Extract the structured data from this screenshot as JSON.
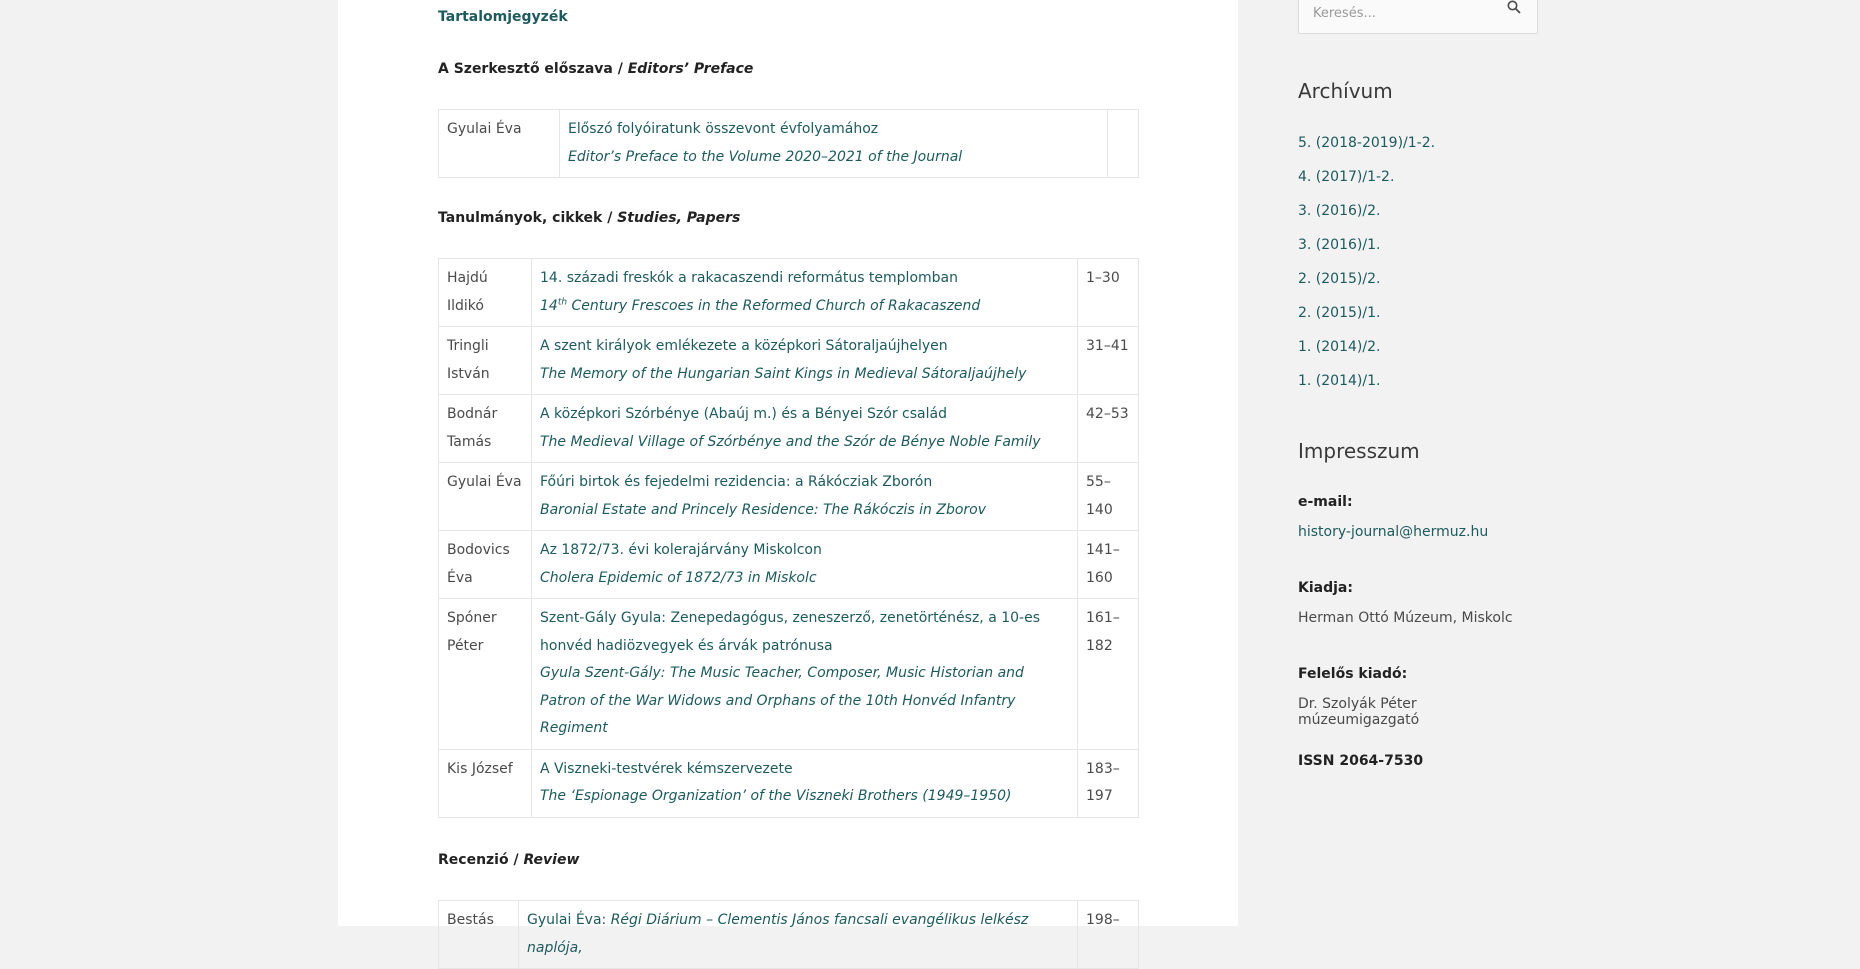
{
  "toc_title": "Tartalomjegyzék",
  "preface": {
    "heading_hu": "A Szerkesztő előszava /",
    "heading_en": "Editors’ Preface",
    "rows": [
      {
        "author": "Gyulai Éva",
        "title_hu": "Előszó folyóiratunk összevont évfolyamához",
        "title_en": "Editor’s Preface to the Volume 2020–2021 of the Journal",
        "pages": ""
      }
    ]
  },
  "studies": {
    "heading_hu": "Tanulmányok, cikkek /",
    "heading_en": "Studies, Papers",
    "rows": [
      {
        "author": "Hajdú Ildikó",
        "title_hu": "14. századi freskók a rakacaszendi református templomban",
        "title_en_sup_num": "14",
        "title_en_sup": "th",
        "title_en": " Century Frescoes in the Reformed Church of Rakacaszend",
        "pages": "1–30"
      },
      {
        "author": "Tringli István",
        "title_hu": "A szent királyok emlékezete a középkori Sátoraljaújhelyen",
        "title_en": "The Memory of the Hungarian Saint Kings in Medieval Sátoraljaújhely",
        "pages": "31–41"
      },
      {
        "author": "Bodnár Tamás",
        "title_hu": "A középkori Szórbénye (Abaúj m.) és a Bényei Szór család",
        "title_en": "The Medieval Village of Szórbénye and the Szór de Bénye Noble Family",
        "pages": "42–53"
      },
      {
        "author": "Gyulai Éva",
        "title_hu": "Főúri birtok és fejedelmi rezidencia: a Rákócziak Zborón",
        "title_en": "Baronial Estate and Princely Residence: The Rákóczis in Zborov",
        "pages": "55–140"
      },
      {
        "author": "Bodovics Éva",
        "title_hu": "Az 1872/73. évi kolerajárvány Miskolcon",
        "title_en": "Cholera Epidemic of 1872/73 in Miskolc",
        "pages": "141–160"
      },
      {
        "author": "Spóner Péter",
        "title_hu": "Szent-Gály Gyula: Zenepedagógus, zeneszerző, zenetörténész, a 10-es honvéd hadiözvegyek és árvák patrónusa",
        "title_en": "Gyula Szent-Gály: The Music Teacher, Composer, Music Historian and Patron of the War Widows and Orphans of the 10th Honvéd Infantry Regiment",
        "pages": "161–182"
      },
      {
        "author": "Kis József",
        "title_hu": "A Viszneki-testvérek kémszervezete",
        "title_en": "The ‘Espionage Organization’ of the Viszneki Brothers (1949–1950)",
        "pages": "183–197"
      }
    ]
  },
  "review": {
    "heading_hu": "Recenzió /",
    "heading_en": "Review",
    "rows": [
      {
        "author": "Bestás",
        "title_prefix": "Gyulai Éva: ",
        "title_em": "Régi Diárium – Clementis János fancsali evangélikus lelkész naplója,",
        "pages": "198–"
      }
    ]
  },
  "sidebar": {
    "search_placeholder": "Keresés...",
    "search_icon": "search-icon",
    "archive_title": "Archívum",
    "archive_items": [
      "5. (2018-2019)/1-2.",
      "4. (2017)/1-2.",
      "3. (2016)/2.",
      "3. (2016)/1.",
      "2. (2015)/2.",
      "2. (2015)/1.",
      "1. (2014)/2.",
      "1. (2014)/1."
    ],
    "impressum_title": "Impresszum",
    "email_label": "e-mail:",
    "email_value": "history-journal@hermuz.hu",
    "publisher_label": "Kiadja:",
    "publisher_value": "Herman Ottó Múzeum, Miskolc",
    "responsible_label": "Felelős kiadó:",
    "responsible_value": "Dr. Szolyák Péter múzeumigazgató",
    "issn": "ISSN 2064-7530"
  },
  "colors": {
    "link": "#1d5a5e",
    "background": "#f2f2f2",
    "content_bg": "#ffffff"
  }
}
